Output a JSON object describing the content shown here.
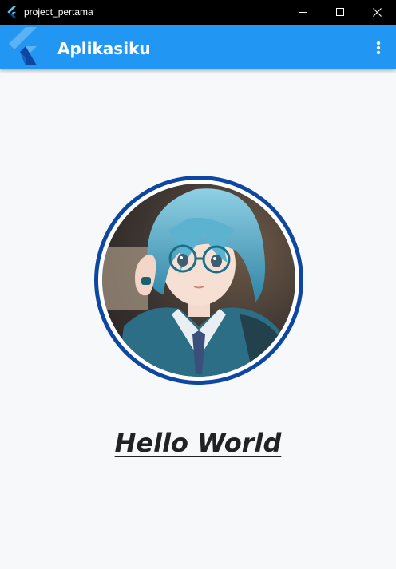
{
  "window": {
    "title": "project_pertama"
  },
  "app_bar": {
    "title": "Aplikasiku",
    "menu_icon": "more-vertical-icon",
    "color": "#2196f3"
  },
  "content": {
    "avatar_border_color": "#0d47a1",
    "greeting": "Hello World"
  }
}
